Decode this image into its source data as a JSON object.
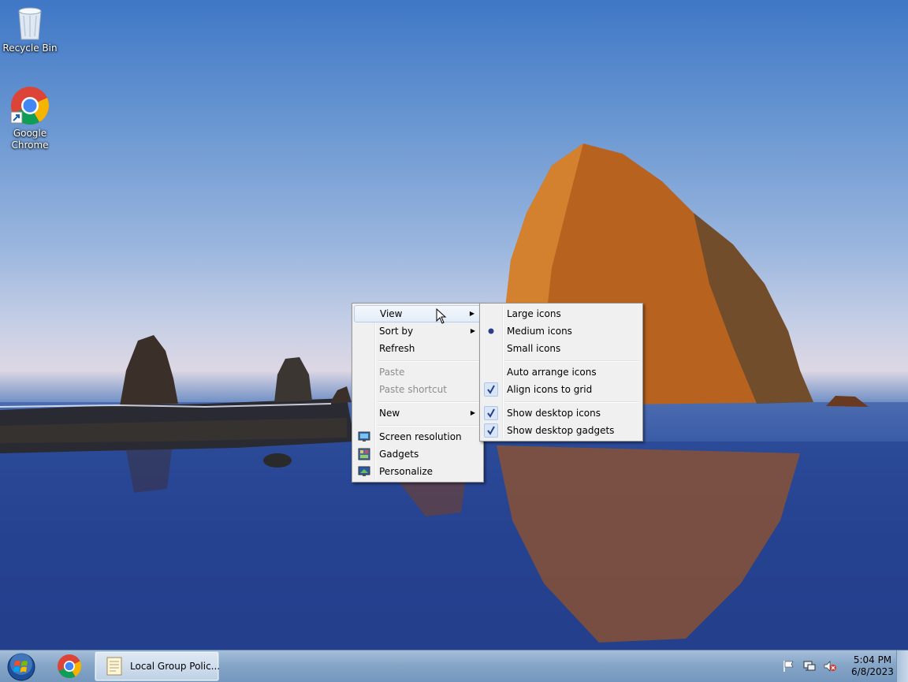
{
  "desktop_icons": [
    {
      "label": "Recycle Bin",
      "icon": "recycle-bin-icon"
    },
    {
      "label": "Google\nChrome",
      "icon": "chrome-icon"
    }
  ],
  "context_menu": {
    "items": [
      {
        "label": "View",
        "submenu": true,
        "highlighted": true
      },
      {
        "label": "Sort by",
        "submenu": true
      },
      {
        "label": "Refresh"
      },
      {
        "label": "Paste",
        "disabled": true
      },
      {
        "label": "Paste shortcut",
        "disabled": true
      },
      {
        "label": "New",
        "submenu": true
      },
      {
        "label": "Screen resolution",
        "icon": "screen-resolution-icon"
      },
      {
        "label": "Gadgets",
        "icon": "gadgets-icon"
      },
      {
        "label": "Personalize",
        "icon": "personalize-icon"
      }
    ]
  },
  "view_submenu": {
    "items": [
      {
        "label": "Large icons"
      },
      {
        "label": "Medium icons",
        "radio_selected": true
      },
      {
        "label": "Small icons"
      },
      {
        "label": "Auto arrange icons"
      },
      {
        "label": "Align icons to grid",
        "checked": true
      },
      {
        "label": "Show desktop icons",
        "checked": true
      },
      {
        "label": "Show desktop gadgets",
        "checked": true
      }
    ]
  },
  "taskbar": {
    "task_label": "Local Group Polic...",
    "clock_time": "5:04 PM",
    "clock_date": "6/8/2023",
    "tray_icons": [
      "action-center-flag-icon",
      "network-icon",
      "volume-muted-icon"
    ]
  }
}
